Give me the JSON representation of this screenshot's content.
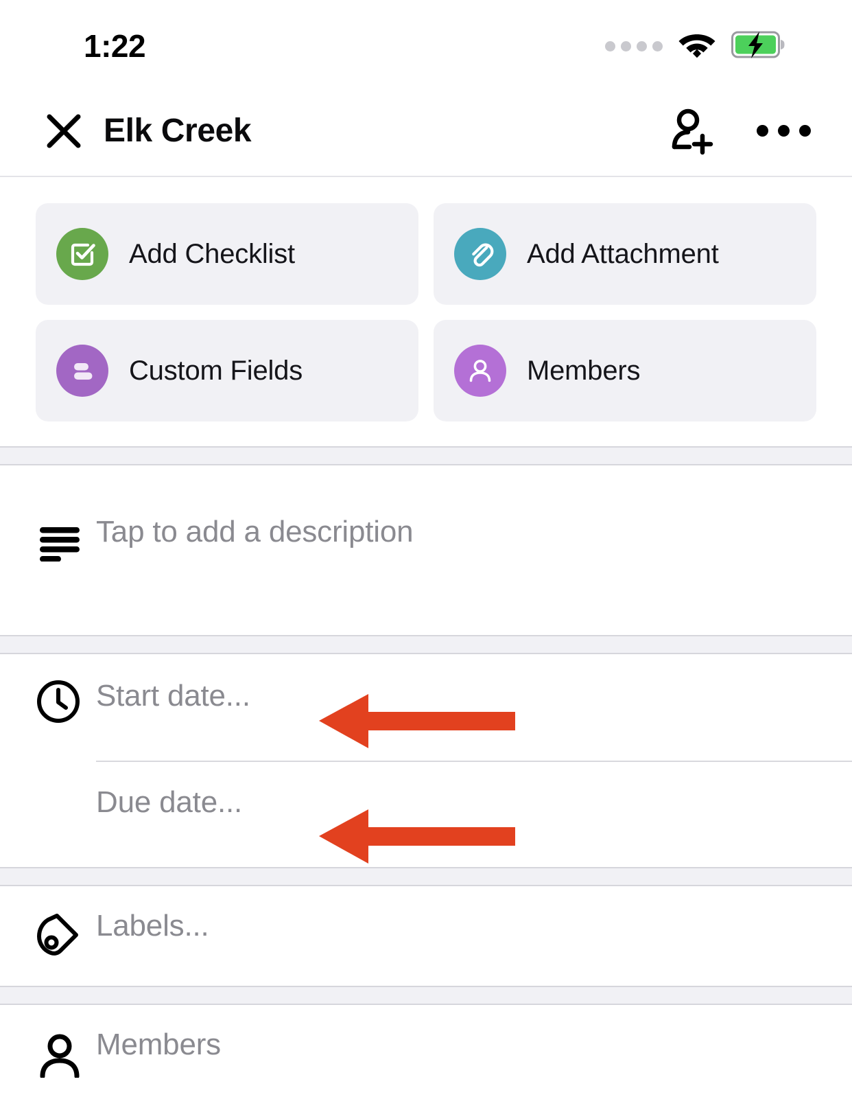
{
  "status_bar": {
    "time": "1:22",
    "signal_icon": "signal-dots-icon",
    "wifi_icon": "wifi-icon",
    "battery_icon": "battery-charging-icon",
    "signal_dots": 4
  },
  "header": {
    "close_icon": "close-icon",
    "title": "Elk Creek",
    "add_member_icon": "person-add-icon",
    "overflow_icon": "more-options-icon"
  },
  "quick_actions": [
    {
      "label": "Add Checklist",
      "icon": "checklist-icon",
      "color": "#68a84c",
      "name": "add-checklist-button"
    },
    {
      "label": "Add Attachment",
      "icon": "paperclip-icon",
      "color": "#49a9bd",
      "name": "add-attachment-button"
    },
    {
      "label": "Custom Fields",
      "icon": "custom-fields-icon",
      "color": "#a267c4",
      "name": "custom-fields-button"
    },
    {
      "label": "Members",
      "icon": "person-icon",
      "color": "#b470d6",
      "name": "members-button"
    }
  ],
  "description": {
    "icon": "description-lines-icon",
    "placeholder": "Tap to add a description"
  },
  "dates": {
    "clock_icon": "clock-icon",
    "start": {
      "placeholder": "Start date...",
      "value": ""
    },
    "due": {
      "placeholder": "Due date...",
      "value": ""
    }
  },
  "labels": {
    "icon": "label-tag-icon",
    "placeholder": "Labels..."
  },
  "members_row": {
    "icon": "person-outline-icon",
    "placeholder": "Members"
  },
  "annotations": {
    "arrow_color": "#e2411f",
    "arrows": [
      {
        "name": "arrow-pointing-start-date",
        "target": "Start date..."
      },
      {
        "name": "arrow-pointing-due-date",
        "target": "Due date..."
      }
    ]
  },
  "colors": {
    "page_background": "#ffffff",
    "card_background": "#f1f1f5",
    "divider": "#d6d6dc",
    "placeholder_text": "#8a8a90",
    "primary_text": "#0b0b0d"
  }
}
